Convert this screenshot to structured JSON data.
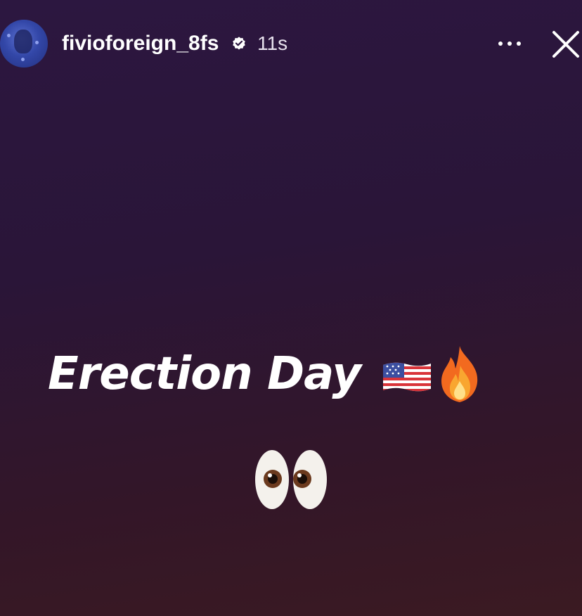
{
  "story": {
    "username": "fivioforeign_8fs",
    "timestamp": "11s",
    "verified_icon": "verified-badge-icon",
    "more_icon": "more-options-icon",
    "close_icon": "close-icon"
  },
  "content": {
    "caption": "Erection Day",
    "emojis": [
      "us-flag-emoji",
      "fire-emoji",
      "eyes-emoji"
    ]
  },
  "colors": {
    "background_top": "#2c1740",
    "background_bottom": "#3b1a22",
    "avatar": "#3347a8",
    "text": "#ffffff"
  }
}
